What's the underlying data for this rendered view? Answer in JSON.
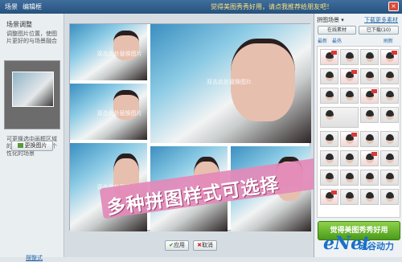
{
  "titlebar": {
    "menu1": "场景",
    "menu2": "编辑框",
    "title": "觉得美图秀秀好用，请点我推荐给朋友吧！",
    "close": "×"
  },
  "left": {
    "title": "场景调整",
    "desc": "调整图片位置，使图片更好的与场景融合",
    "tip": "可更换选中画框区域的图片，实现更多个性化的场景",
    "replace_btn": "更换图片",
    "link": "摆整式"
  },
  "canvas": {
    "watermark": "双击此处替换图片",
    "banner": "多种拼图样式可选择",
    "ok_btn": "应用",
    "cancel_btn": "取消"
  },
  "right": {
    "dropdown": "拼图场景",
    "more": "下载更多素材",
    "tab1": "在线素材",
    "tab2": "已下载(10)",
    "cat1": "最新",
    "cat2": "最热",
    "refresh": "刷新",
    "green_btn": "觉得美图秀秀好用"
  },
  "logo": {
    "brand": "eNet",
    "site": "硅谷动力"
  }
}
